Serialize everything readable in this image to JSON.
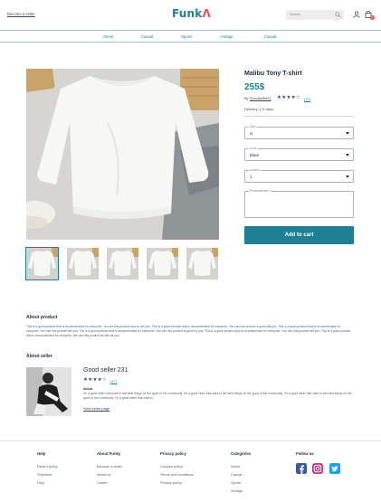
{
  "header": {
    "become_seller": "Become a seller",
    "logo_main": "Funk",
    "logo_accent": "Λ",
    "search_placeholder": "Search",
    "cart_count": "0"
  },
  "nav": [
    "Street",
    "Casual",
    "Sports",
    "Vintage",
    "Casual"
  ],
  "product": {
    "title": "Malibu Tony T-shirt",
    "price": "255$",
    "by_prefix": "By",
    "seller": "Goodseller21",
    "rating_stars": "★★★★☆",
    "rating_count": "(17)",
    "delivery": "Delivery: 2-5 days",
    "fields": [
      {
        "label": "Size",
        "value": "xl"
      },
      {
        "label": "Color",
        "value": "Black"
      },
      {
        "label": "Amount",
        "value": "1"
      }
    ],
    "personalization_label": "Personalization",
    "add_to_cart": "Add to cart"
  },
  "about_product": {
    "heading": "About product",
    "text": "This is a good product that is recommended for everyone. You are this product and so will you. This is a good product that is recommended for everyone. You can this product a good will you. This is a good product that is recommended for everyone. You can this product will you. The is a good product that is recommended for everyone. You can this product is good for you. This is a good product that is recommended for everyone. You can this product will you. This is a good product that is recommended for everyone. We use this product as well as you."
  },
  "about_seller": {
    "heading": "About seller",
    "name": "Good seller 231",
    "rating_stars": "★★★★☆",
    "rating_count": "(27)",
    "about_heading": "About",
    "about_text": "I'm a good seller that want to sell best things for the good of the community. I'm a good seller that want to sell best things for the good of the community. I'm a good seller that want to sell best things for the good of the community. I'm a good seller that want to.",
    "view_link": "View seller page"
  },
  "footer": {
    "columns": [
      {
        "heading": "Help",
        "links": [
          "Return policy",
          "Shipment",
          "Help"
        ]
      },
      {
        "heading": "About Funky",
        "links": [
          "Become a seller",
          "About us",
          "Career"
        ]
      },
      {
        "heading": "Privacy policy",
        "links": [
          "Cookies policy",
          "Terms and conditions",
          "Privacy policy"
        ]
      },
      {
        "heading": "Categories",
        "links": [
          "Street",
          "Casual",
          "Sports",
          "Vintage"
        ]
      },
      {
        "heading": "Follow us",
        "links": []
      }
    ],
    "social": [
      "facebook-icon",
      "instagram-icon",
      "twitter-icon"
    ]
  },
  "colors": {
    "brand": "#1f7f93",
    "accent": "#ef4a56",
    "text": "#1f2f3d"
  }
}
